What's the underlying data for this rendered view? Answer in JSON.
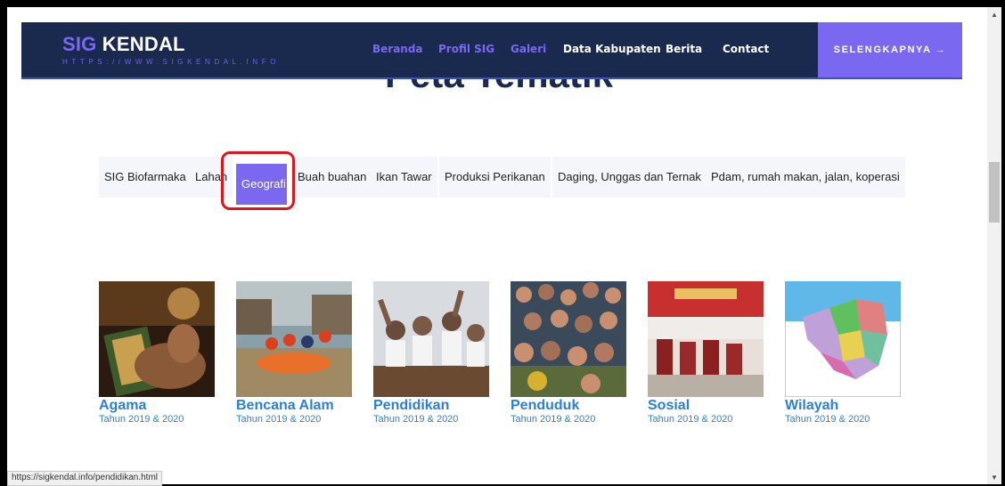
{
  "brand": {
    "title_accent": "SIG",
    "title_rest": " KENDAL",
    "url": "HTTPS://WWW.SIGKENDAL.INFO"
  },
  "nav": {
    "items": [
      {
        "label": "Beranda"
      },
      {
        "label": "Profil SIG"
      },
      {
        "label": "Galeri"
      },
      {
        "label": "Data Kabupaten"
      },
      {
        "label": "Berita"
      },
      {
        "label": "Contact"
      }
    ],
    "cta": "SELENGKAPNYA →"
  },
  "section": {
    "title": "Peta Tematik"
  },
  "tabs": [
    {
      "label": "SIG Biofarmaka"
    },
    {
      "label": "Lahan"
    },
    {
      "label": "Geografi"
    },
    {
      "label": "Buah buahan"
    },
    {
      "label": "Ikan Tawar"
    },
    {
      "label": "Produksi Perikanan"
    },
    {
      "label": "Daging, Unggas dan Ternak"
    },
    {
      "label": "Pdam, rumah makan, jalan, koperasi"
    }
  ],
  "gallery": [
    {
      "title": "Agama",
      "sub": "Tahun 2019 & 2020"
    },
    {
      "title": "Bencana Alam",
      "sub": "Tahun 2019 & 2020"
    },
    {
      "title": "Pendidikan",
      "sub": "Tahun 2019 & 2020"
    },
    {
      "title": "Penduduk",
      "sub": "Tahun 2019 & 2020"
    },
    {
      "title": "Sosial",
      "sub": "Tahun 2019 & 2020"
    },
    {
      "title": "Wilayah",
      "sub": "Tahun 2019 & 2020"
    }
  ],
  "status_bar": "https://sigkendal.info/pendidikan.html",
  "colors": {
    "navy": "#1a2a4e",
    "purple": "#7a68f0",
    "link_blue": "#2b80d6",
    "highlight_red": "#e1141c"
  }
}
